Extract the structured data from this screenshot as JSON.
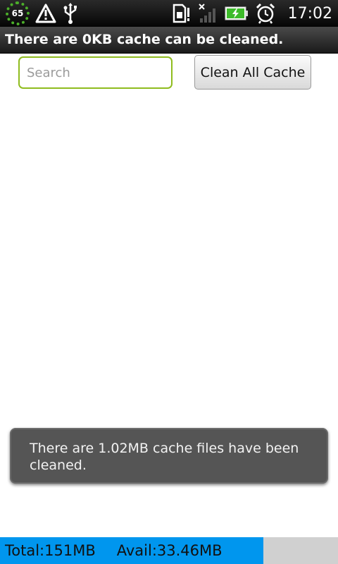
{
  "status_bar": {
    "battery_level": "65",
    "time": "17:02"
  },
  "title": "There are 0KB cache can be cleaned.",
  "search": {
    "placeholder": "Search",
    "value": ""
  },
  "clean_button_label": "Clean All Cache",
  "toast": {
    "message": "There are 1.02MB cache files have been cleaned."
  },
  "storage": {
    "total_label": "Total:151MB",
    "avail_label": "Avail:33.46MB",
    "used_fraction": 0.78,
    "used_color": "#0096ee",
    "free_color": "#d0d0d0"
  },
  "colors": {
    "search_border": "#8fbc1e",
    "battery_ring": "#4caf2a"
  }
}
